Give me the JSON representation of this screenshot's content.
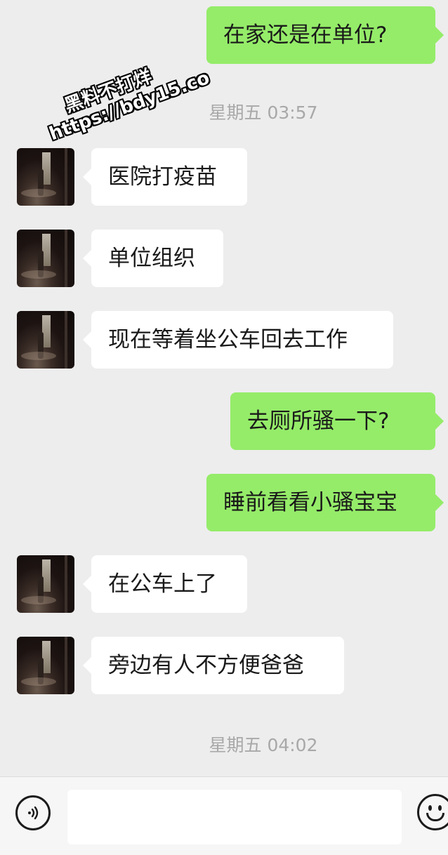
{
  "chat": {
    "messages": [
      {
        "from": "me",
        "text": "在家还是在单位?"
      },
      {
        "type": "timestamp",
        "text": "星期五 03:57"
      },
      {
        "from": "other",
        "text": "医院打疫苗"
      },
      {
        "from": "other",
        "text": "单位组织"
      },
      {
        "from": "other",
        "text": "现在等着坐公车回去工作"
      },
      {
        "from": "me",
        "text": "去厕所骚一下?"
      },
      {
        "from": "me",
        "text": "睡前看看小骚宝宝"
      },
      {
        "from": "other",
        "text": "在公车上了"
      },
      {
        "from": "other",
        "text": "旁边有人不方便爸爸"
      },
      {
        "type": "timestamp",
        "text": "星期五 04:02"
      }
    ]
  },
  "watermark": {
    "line1": "黑料不打烊",
    "line2": "https://bdy15.co"
  },
  "input_bar": {
    "voice_icon": "voice-icon",
    "emoji_icon": "emoji-icon",
    "message_value": ""
  },
  "colors": {
    "background": "#ededed",
    "outgoing_bubble": "#95ec69",
    "incoming_bubble": "#ffffff",
    "timestamp_text": "#a8a8a8"
  }
}
